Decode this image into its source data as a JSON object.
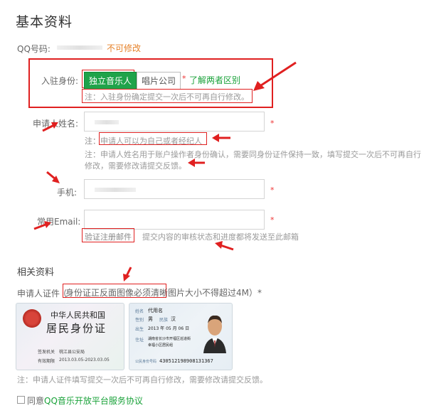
{
  "page_title": "基本资料",
  "qq": {
    "label": "QQ号码:",
    "note": "不可修改"
  },
  "identity": {
    "label": "入驻身份:",
    "option_selected": "独立音乐人",
    "option_other": "唱片公司",
    "star": "*",
    "diff_link": "了解两者区别",
    "note": "注：入驻身份确定提交一次后不可再自行修改。"
  },
  "applicant_name": {
    "label": "申请人姓名:",
    "star": "*",
    "note1": "注：申请人可以为自己或者经纪人",
    "note2": "注：申请人姓名用于账户操作者身份确认，需要同身份证件保持一致，填写提交一次后不可再自行",
    "note3": "修改，需要修改请提交反馈。"
  },
  "phone": {
    "label": "手机:",
    "star": "*"
  },
  "email": {
    "label": "常用Email:",
    "star": "*",
    "verify_button": "验证注册邮件",
    "note": "提交内容的审核状态和进度都将发送至此邮箱"
  },
  "related_title": "相关资料",
  "id_doc": {
    "label": "申请人证件",
    "requirement": "身份证正反面图像必须清晰",
    "size_note": "图片大小不得超过4M）*"
  },
  "card_front": {
    "line1": "中华人民共和国",
    "line2": "居民身份证",
    "issuer_label": "签发机关",
    "issuer": "桃江县公安局",
    "valid_label": "有效期限",
    "valid": "2013.03.05-2023.03.05"
  },
  "card_back": {
    "name_label": "姓名",
    "name": "代用名",
    "gender_label": "性别",
    "gender": "男",
    "ethnic_label": "民族",
    "ethnic": "汉",
    "birth_label": "出生",
    "birth": "2013 年 05 月 06 日",
    "addr_label": "住址",
    "addr1": "湖南省长沙市开福区巡道街",
    "addr2": "幸福小区居民组",
    "id_label": "公民身份号码",
    "id_number": "430512198908131367"
  },
  "footer_note": "注：申请人证件填写提交一次后不可再自行修改，需要修改请提交反馈。",
  "agree": {
    "prefix": "同意",
    "link": "QQ音乐开放平台服务协议"
  },
  "colors": {
    "annotation_red": "#e02020",
    "primary_green": "#1fa34a",
    "warning_orange": "#e6822a"
  }
}
